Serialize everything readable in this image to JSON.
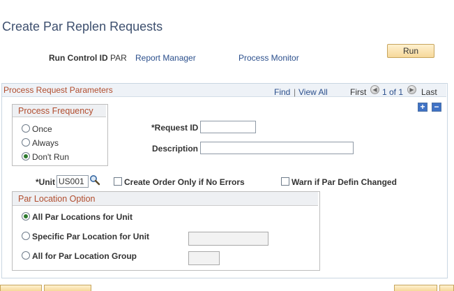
{
  "page": {
    "title": "Create Par Replen Requests"
  },
  "run_control": {
    "label": "Run Control ID",
    "value": "PAR",
    "report_manager": "Report Manager",
    "process_monitor": "Process Monitor",
    "run_button": "Run"
  },
  "panel": {
    "title": "Process Request Parameters",
    "find": "Find",
    "separator": "|",
    "view_all": "View All",
    "first": "First",
    "count": "1 of 1",
    "last": "Last"
  },
  "frequency": {
    "title": "Process Frequency",
    "options": [
      "Once",
      "Always",
      "Don't Run"
    ],
    "selected": "Don't Run"
  },
  "fields": {
    "request_id_label": "*Request ID",
    "request_id_value": "",
    "description_label": "Description",
    "description_value": "",
    "unit_label": "*Unit",
    "unit_value": "US001",
    "create_order_label": "Create Order Only if No Errors",
    "warn_label": "Warn if Par Defin Changed"
  },
  "location_option": {
    "title": "Par Location Option",
    "options": [
      "All Par Locations for Unit",
      "Specific Par Location for Unit",
      "All for Par Location Group"
    ],
    "selected": "All Par Locations for Unit",
    "specific_value": "",
    "group_value": ""
  },
  "icons": {
    "lookup": "magnifier-icon",
    "add_row": "plus-icon",
    "delete_row": "minus-icon",
    "prev": "arrow-left-icon",
    "next": "arrow-right-icon"
  },
  "colors": {
    "title": "#3d4f6e",
    "link": "#2b4f8c",
    "section_title": "#b14d2e",
    "button_bg": "#f6d89a",
    "row_button": "#3f72c5",
    "radio_selected": "#2d7a2d"
  }
}
